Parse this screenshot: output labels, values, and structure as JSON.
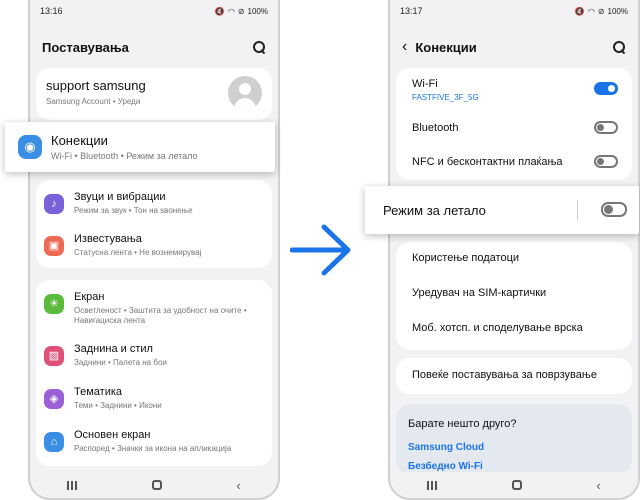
{
  "left_phone": {
    "status": {
      "time": "13:16",
      "battery": "100%"
    },
    "header_title": "Поставувања",
    "account": {
      "name": "support samsung",
      "sub": "Samsung Account  •  Уреди"
    },
    "highlight": {
      "label": "Конекции",
      "sub": "Wi-Fi  •  Bluetooth  •  Режим за летало"
    },
    "items": [
      {
        "label": "Звуци и вибрации",
        "sub": "Режим за звук  •  Тон на ѕвонење",
        "icon": "speaker-icon",
        "color": "#7b61d9"
      },
      {
        "label": "Известувања",
        "sub": "Статусна лента  •  Не вознемирувај",
        "icon": "notification-icon",
        "color": "#ee6a55"
      },
      {
        "label": "Екран",
        "sub": "Осветленост  •  Заштита за удобност на очите  •  Навигациска лента",
        "icon": "sun-icon",
        "color": "#5cbb3c"
      },
      {
        "label": "Заднина и стил",
        "sub": "Заднини  •  Палета на бои",
        "icon": "image-icon",
        "color": "#e0517a"
      },
      {
        "label": "Тематика",
        "sub": "Теми  •  Заднини  •  Икони",
        "icon": "theme-icon",
        "color": "#9b5fd8"
      },
      {
        "label": "Основен екран",
        "sub": "Распоред  •  Значки за икона на апликација",
        "icon": "home-icon",
        "color": "#3a8ee6"
      }
    ],
    "connections_icon_color": "#3a8ee6"
  },
  "right_phone": {
    "status": {
      "time": "13:17",
      "battery": "100%"
    },
    "header_title": "Конекции",
    "wifi": {
      "label": "Wi-Fi",
      "network": "FASTFIVE_3F_5G",
      "on": true
    },
    "bluetooth": {
      "label": "Bluetooth",
      "on": false
    },
    "nfc": {
      "label": "NFC и бесконтактни плаќања",
      "on": false
    },
    "airplane": {
      "label": "Режим за летало",
      "on": false
    },
    "data_usage": "Користење податоци",
    "sim_manager": "Уредувач на SIM-картички",
    "hotspot": "Моб. хотсп. и споделување врска",
    "more_settings": "Повеќе поставувања за поврзување",
    "looking": {
      "question": "Барате нешто друго?",
      "link1": "Samsung Cloud",
      "link2": "Безбедно Wi-Fi"
    }
  },
  "accent_color": "#1a73e8"
}
